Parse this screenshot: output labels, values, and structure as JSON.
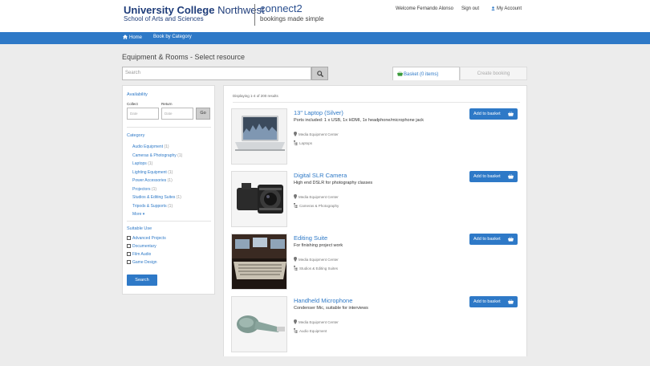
{
  "header": {
    "brand_bold": "University College",
    "brand_light": "Northwest",
    "brand_sub": "School of Arts and Sciences",
    "product": "connect2",
    "product_tagline": "bookings made simple",
    "welcome": "Welcome Fernando Alonso",
    "sign_out": "Sign out",
    "my_account": "My Account"
  },
  "nav": {
    "home": "Home",
    "book_by_category": "Book by Category"
  },
  "page": {
    "title": "Equipment & Rooms - Select resource",
    "search_placeholder": "Search"
  },
  "tabs": {
    "basket": "Basket (0 items)",
    "create_booking": "Create booking"
  },
  "sidebar": {
    "availability": "Availability",
    "collect_label": "Collect",
    "return_label": "Return",
    "date_placeholder": "Date",
    "go": "Go",
    "category_heading": "Category",
    "categories": [
      {
        "name": "Audio Equipment",
        "count": "(1)"
      },
      {
        "name": "Cameras & Photography",
        "count": "(1)"
      },
      {
        "name": "Laptops",
        "count": "(1)"
      },
      {
        "name": "Lighting Equipment",
        "count": "(1)"
      },
      {
        "name": "Power Accessories",
        "count": "(1)"
      },
      {
        "name": "Projectors",
        "count": "(1)"
      },
      {
        "name": "Studios & Editing Suites",
        "count": "(1)"
      },
      {
        "name": "Tripods & Supports",
        "count": "(1)"
      }
    ],
    "more": "More",
    "suitable_use_heading": "Suitable Use",
    "suitable_uses": [
      "Advanced Projects",
      "Documentary",
      "Film Audio",
      "Game Design"
    ],
    "search_button": "Search"
  },
  "results": {
    "count_text": "Displaying 1-4 of 200 results",
    "add_label": "Add to basket",
    "items": [
      {
        "title": "13\" Laptop (Silver)",
        "description": "Ports included: 1 x USB, 1x HDMI, 1x headphone/microphone jack",
        "location": "Media Equipment Center",
        "category": "Laptops"
      },
      {
        "title": "Digital SLR Camera",
        "description": "High end DSLR for photography classes",
        "location": "Media Equipment Center",
        "category": "Cameras & Photography"
      },
      {
        "title": "Editing Suite",
        "description": "For finishing project work",
        "location": "Media Equipment Center",
        "category": "Studios & Editing Suites"
      },
      {
        "title": "Handheld Microphone",
        "description": "Condenser Mic, suitable for interviews",
        "location": "Media Equipment Center",
        "category": "Audio Equipment"
      }
    ]
  },
  "colors": {
    "brand_blue": "#2e79c7",
    "navy": "#1f3d7a",
    "basket_green": "#3a9a3a"
  }
}
